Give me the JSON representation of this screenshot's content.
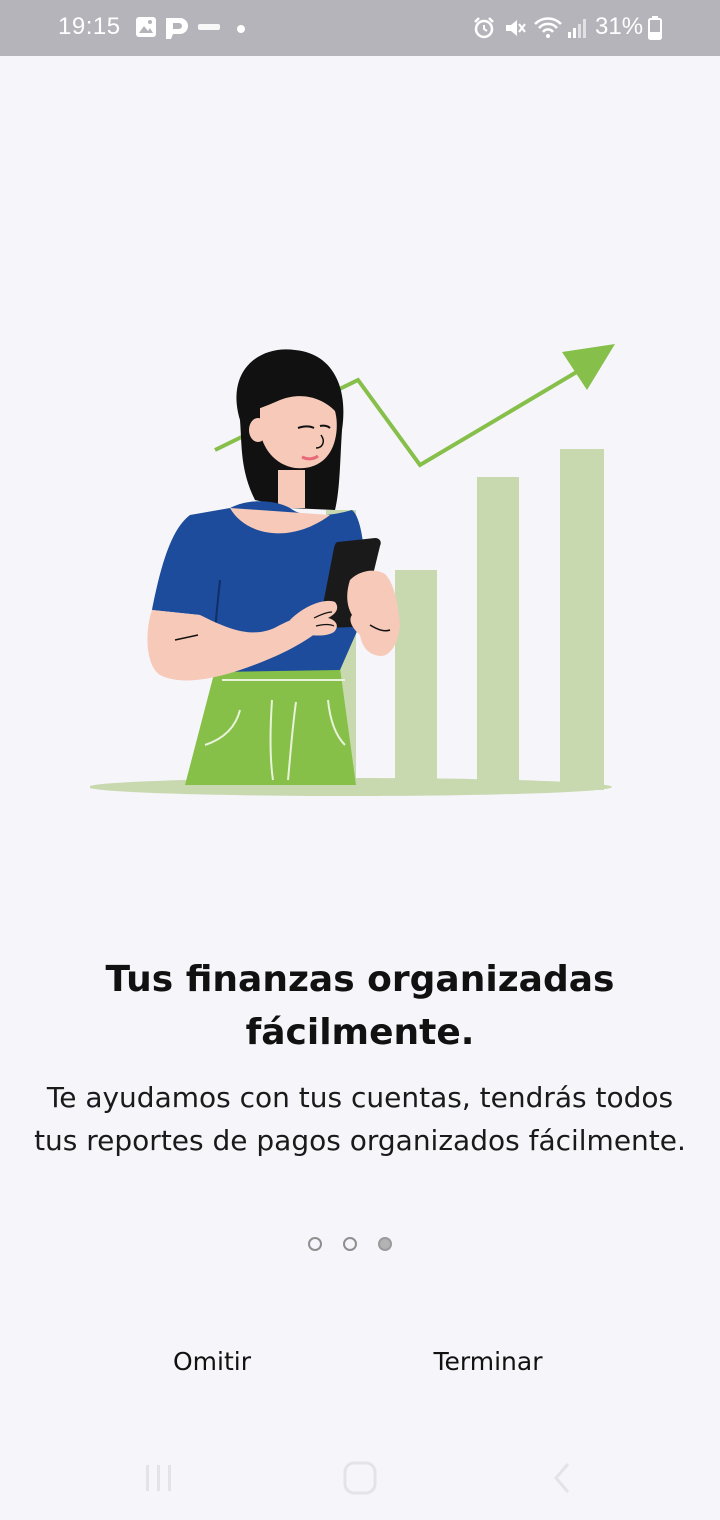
{
  "status_bar": {
    "time": "19:15",
    "battery_percent": "31%",
    "left_icons": [
      "gallery-icon",
      "parking-app-icon",
      "turbo-icon",
      "notification-dot-icon"
    ],
    "right_icons": [
      "alarm-icon",
      "mute-icon",
      "wifi-icon",
      "signal-icon",
      "battery-icon"
    ]
  },
  "onboarding": {
    "title": "Tus finanzas organizadas fácilmente.",
    "description": "Te ayudamos con tus cuentas, tendrás todos tus reportes de pagos organizados fácilmente.",
    "page_count": 3,
    "active_page": 3
  },
  "actions": {
    "skip_label": "Omitir",
    "finish_label": "Terminar"
  },
  "colors": {
    "background": "#f6f5fa",
    "status_bar": "#b5b4ba",
    "chart_bars": "#c8d9b0",
    "trend_line": "#86bf4a",
    "shirt": "#1c4c9b",
    "skirt": "#86c049",
    "hair": "#111111"
  },
  "navigation_bar": {
    "icons": [
      "recent-apps-icon",
      "home-icon",
      "back-icon"
    ]
  }
}
